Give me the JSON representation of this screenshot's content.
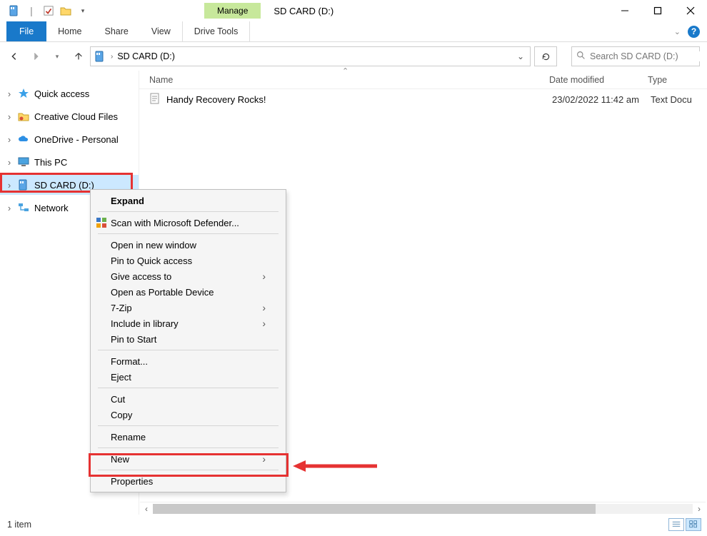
{
  "title_bar": {
    "contextual_tab": "Manage",
    "window_title": "SD CARD (D:)"
  },
  "ribbon": {
    "file": "File",
    "home": "Home",
    "share": "Share",
    "view": "View",
    "drive_tools": "Drive Tools"
  },
  "address_bar": {
    "path": "SD CARD (D:)"
  },
  "search": {
    "placeholder": "Search SD CARD (D:)"
  },
  "nav_pane": {
    "items": [
      {
        "label": "Quick access",
        "icon": "star"
      },
      {
        "label": "Creative Cloud Files",
        "icon": "cc"
      },
      {
        "label": "OneDrive - Personal",
        "icon": "cloud"
      },
      {
        "label": "This PC",
        "icon": "pc"
      },
      {
        "label": "SD CARD (D:)",
        "icon": "sd",
        "selected": true
      },
      {
        "label": "Network",
        "icon": "net"
      }
    ]
  },
  "columns": {
    "name": "Name",
    "date": "Date modified",
    "type": "Type"
  },
  "files": [
    {
      "name": "Handy Recovery Rocks!",
      "date": "23/02/2022 11:42 am",
      "type": "Text Docu"
    }
  ],
  "context_menu": {
    "expand": "Expand",
    "scan": "Scan with Microsoft Defender...",
    "open_new_window": "Open in new window",
    "pin_quick_access": "Pin to Quick access",
    "give_access_to": "Give access to",
    "open_portable": "Open as Portable Device",
    "seven_zip": "7-Zip",
    "include_in_library": "Include in library",
    "pin_start": "Pin to Start",
    "format": "Format...",
    "eject": "Eject",
    "cut": "Cut",
    "copy": "Copy",
    "rename": "Rename",
    "new": "New",
    "properties": "Properties"
  },
  "status_bar": {
    "count": "1 item"
  }
}
